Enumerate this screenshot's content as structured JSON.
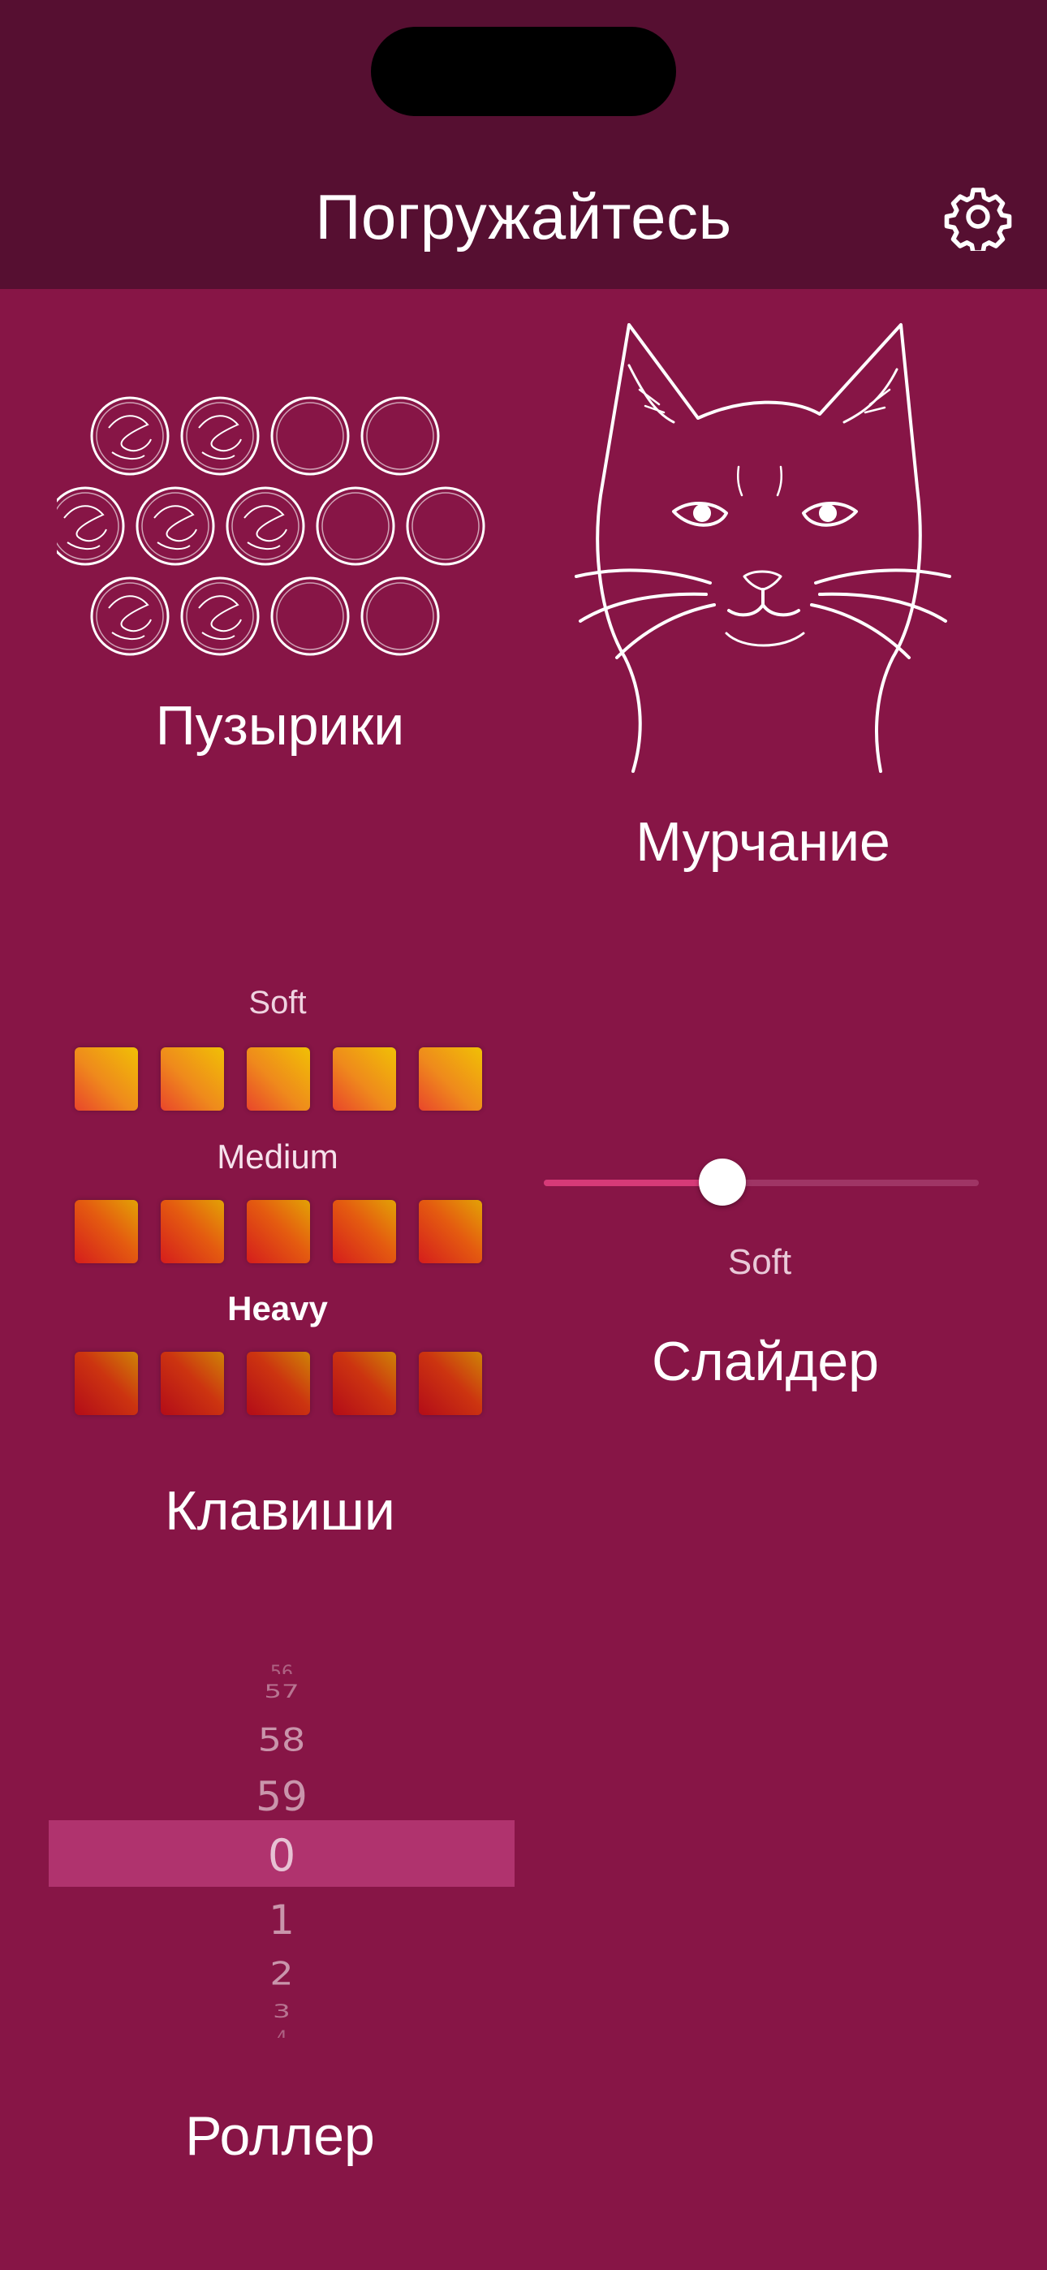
{
  "header": {
    "title": "Погружайтесь"
  },
  "icons": {
    "settings": "gear-icon"
  },
  "bubbles": {
    "label": "Пузырики",
    "popped": [
      true,
      true,
      false,
      false,
      true,
      true,
      true,
      false,
      false,
      true,
      true,
      false,
      false
    ]
  },
  "purr": {
    "label": "Мурчание"
  },
  "keys": {
    "label": "Клавиши",
    "rows": [
      {
        "label": "Soft",
        "count": 5
      },
      {
        "label": "Medium",
        "count": 5
      },
      {
        "label": "Heavy",
        "count": 5
      }
    ]
  },
  "slider": {
    "label": "Слайдер",
    "value_label": "Soft",
    "value_fraction": 0.41
  },
  "roller": {
    "label": "Роллер",
    "items": [
      "56",
      "57",
      "58",
      "59",
      "0",
      "1",
      "2",
      "3",
      "4"
    ],
    "selected": "0"
  },
  "colors": {
    "background": "#871546",
    "header": "#560f31",
    "accent": "#d63a78"
  }
}
